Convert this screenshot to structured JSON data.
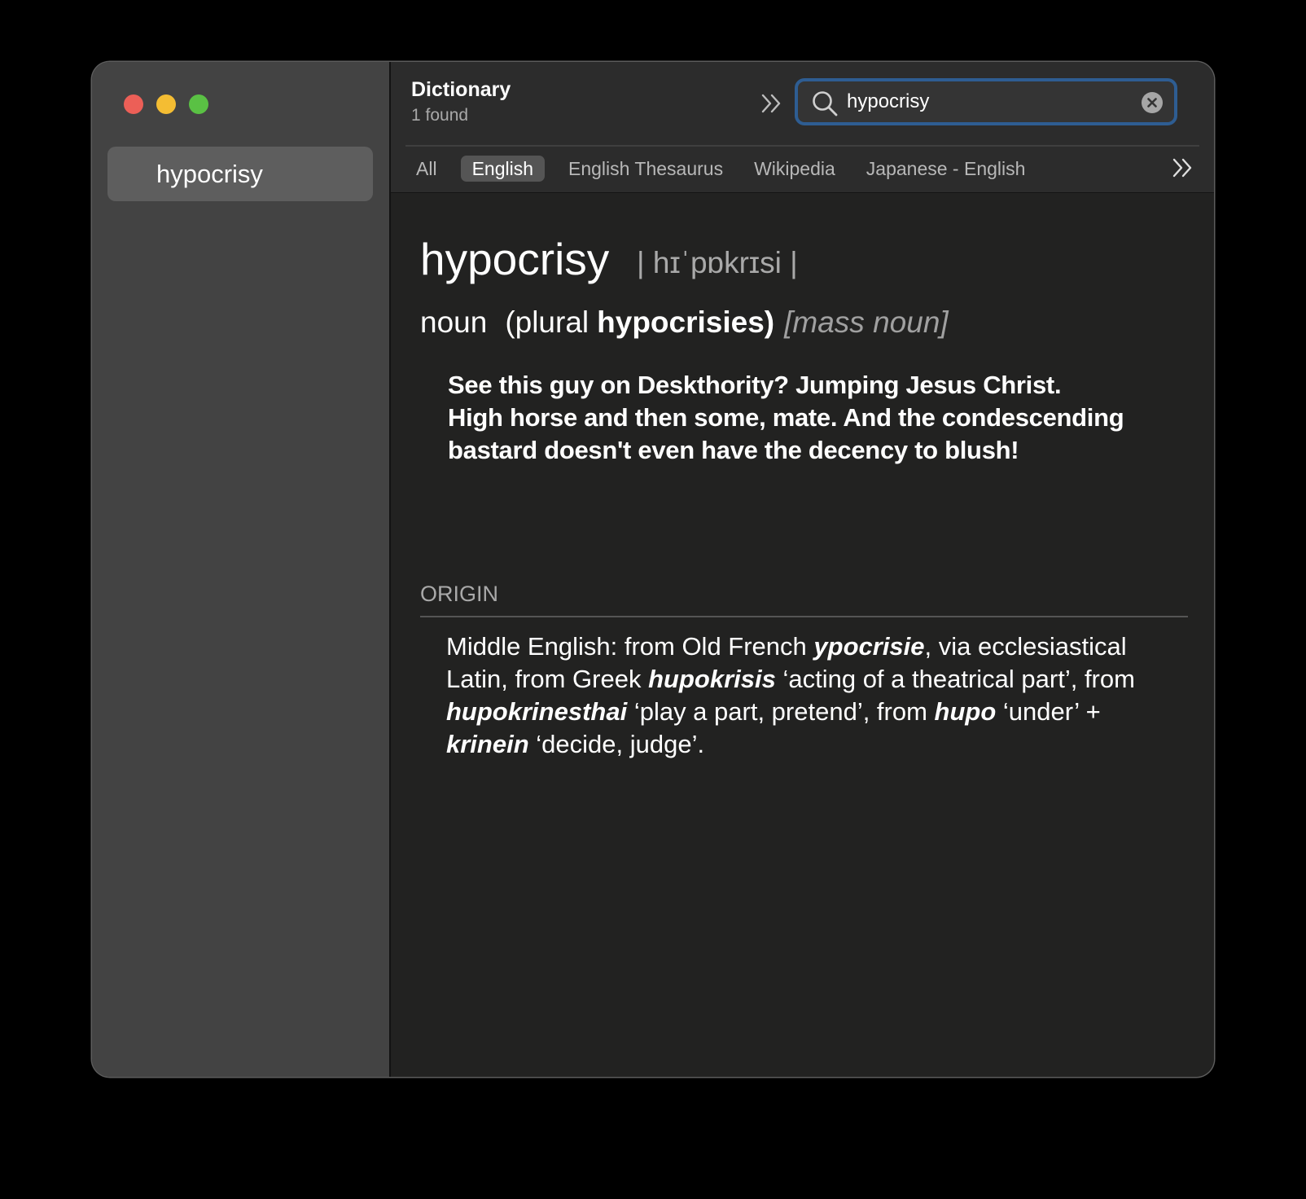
{
  "sidebar": {
    "items": [
      {
        "label": "hypocrisy"
      }
    ]
  },
  "toolbar": {
    "title": "Dictionary",
    "found": "1 found",
    "search_value": "hypocrisy"
  },
  "tabs": [
    {
      "label": "All"
    },
    {
      "label": "English",
      "active": true
    },
    {
      "label": "English Thesaurus"
    },
    {
      "label": "Wikipedia"
    },
    {
      "label": "Japanese - English"
    }
  ],
  "entry": {
    "headword": "hypocrisy",
    "pronunciation": "| hɪˈpɒkrɪsi |",
    "pos": "noun",
    "plural_label": "(plural",
    "plural_form": "hypocrisies)",
    "grammar": "[mass noun]",
    "definition_lines": [
      "See this guy on Deskthority? Jumping Jesus Christ.",
      "High horse and then some, mate. And the condescending",
      "bastard doesn't even have the decency to blush!"
    ]
  },
  "origin": {
    "label": "ORIGIN",
    "segments": {
      "s1": "Middle English: from Old French ",
      "w1": "ypocrisie",
      "s2": ", via ecclesiastical",
      "s3": "Latin, from Greek ",
      "w2": "hupokrisis",
      "s4": " ‘acting of a theatrical part’, from",
      "w3": "hupokrinesthai",
      "s5": " ‘play a part, pretend’, from ",
      "w4": "hupo",
      "s6": " ‘under’ +",
      "w5": "krinein",
      "s7": " ‘decide, judge’."
    }
  },
  "colors": {
    "accent_focus_ring": "#2e5d92",
    "close": "#ec5f57",
    "minimize": "#f4bd33",
    "zoom": "#5ac144"
  }
}
